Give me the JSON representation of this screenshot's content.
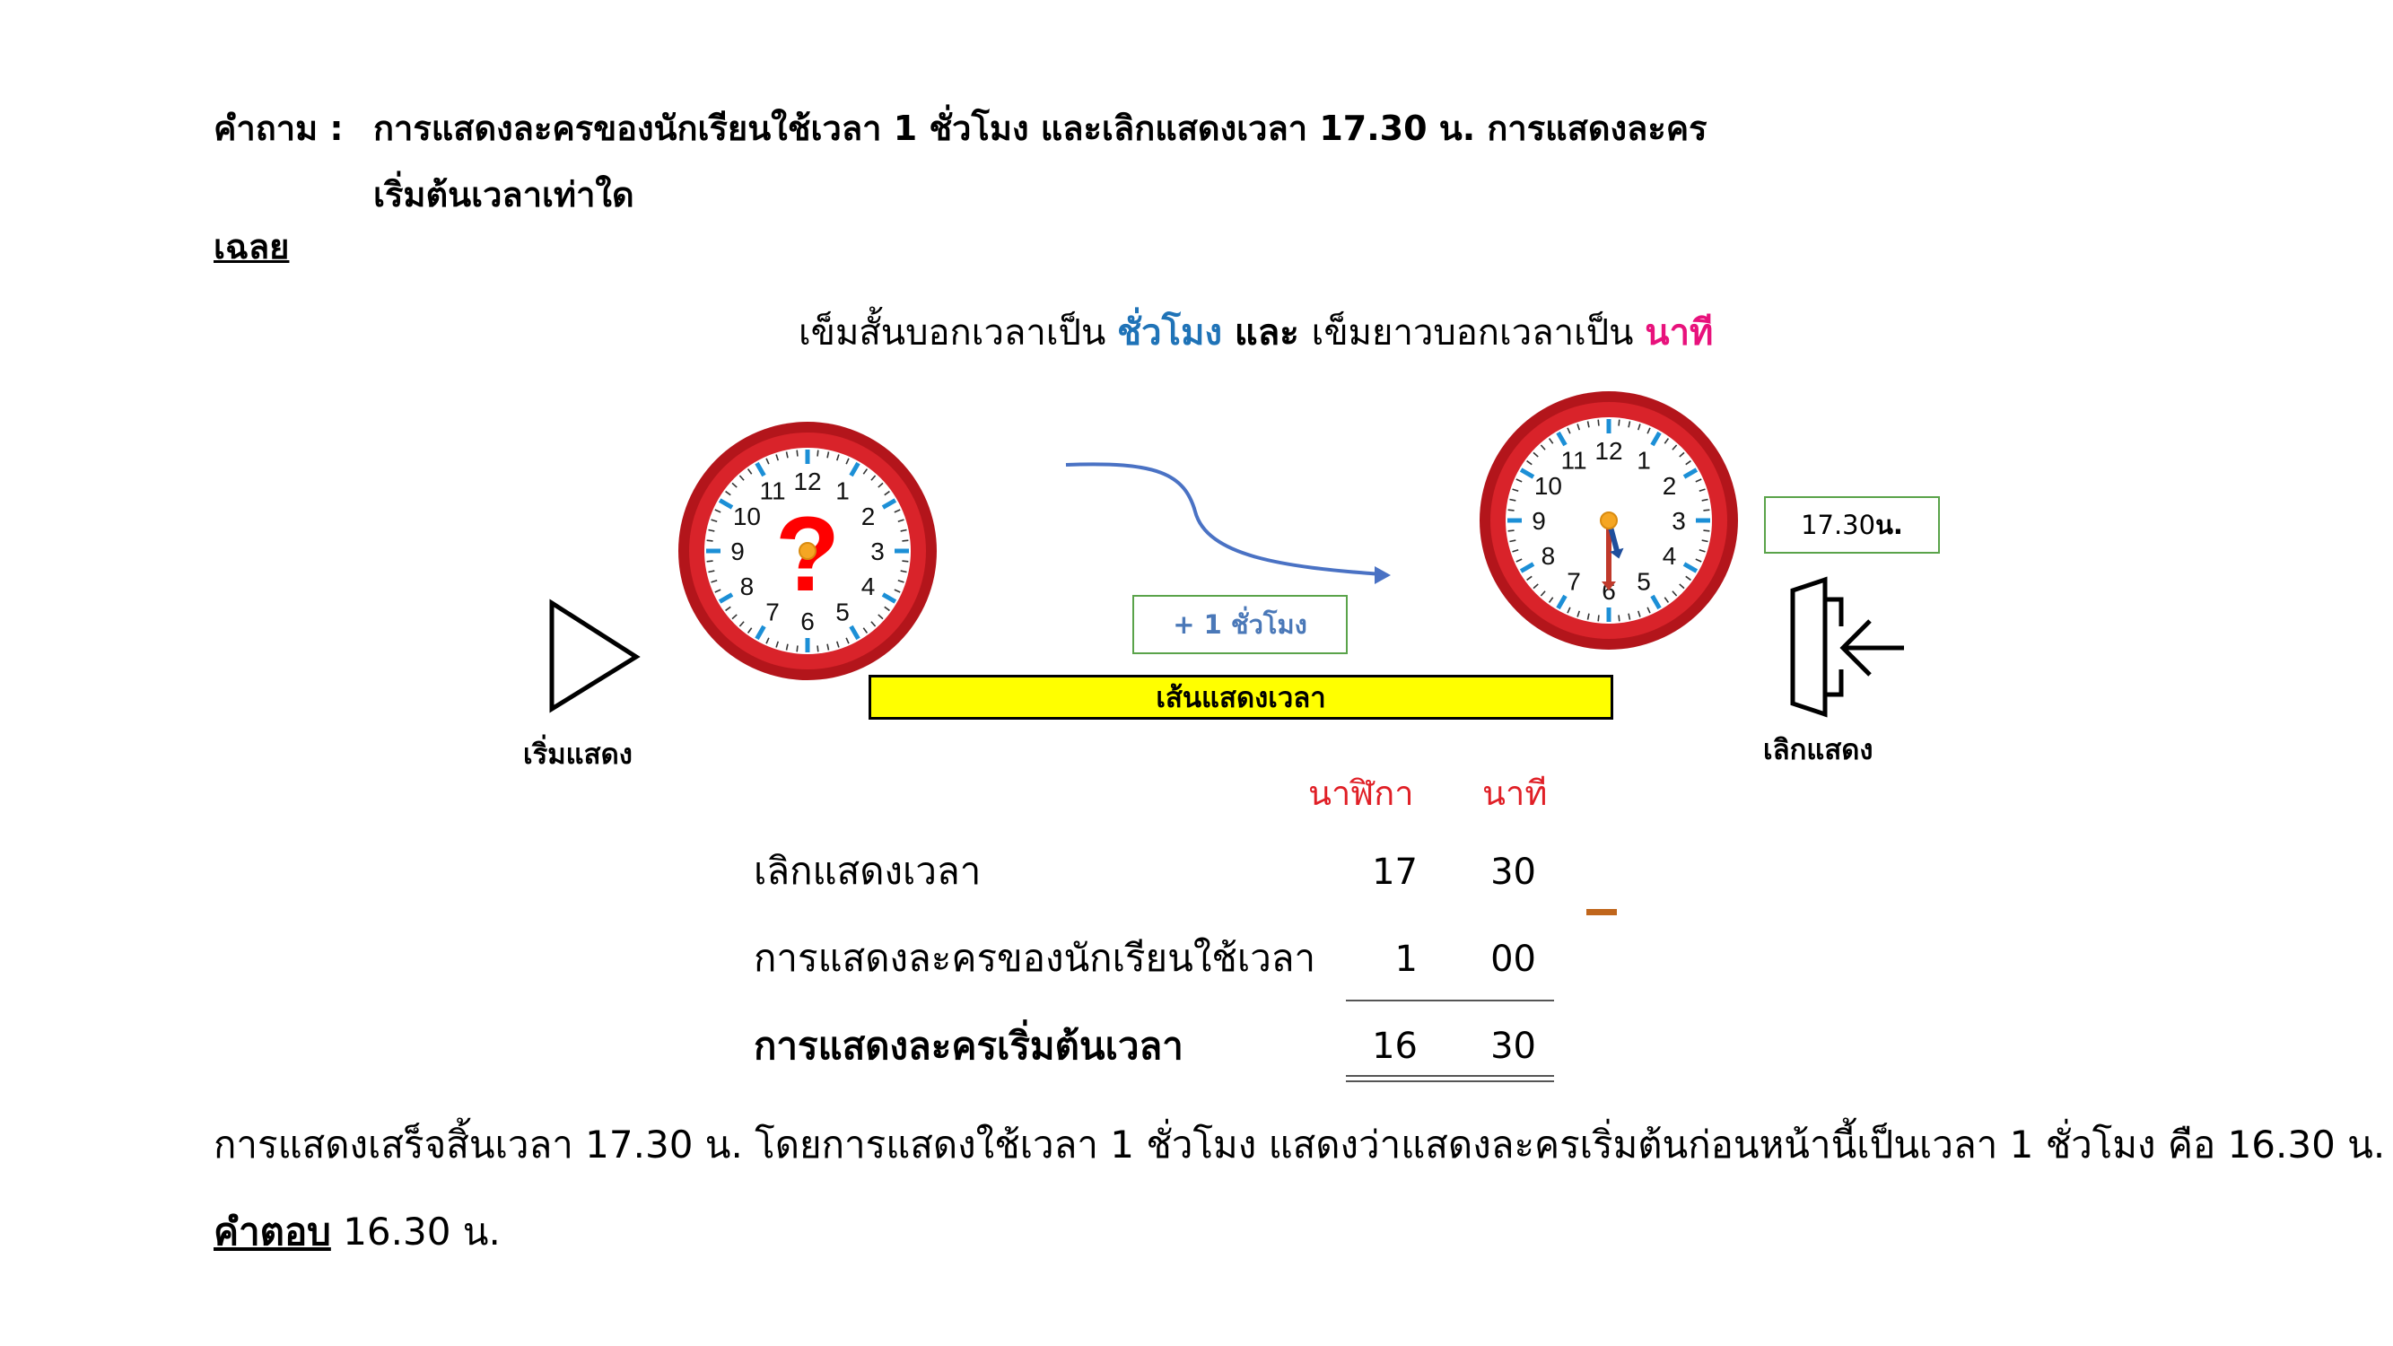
{
  "question": {
    "label": "คำถาม :",
    "line1": "การแสดงละครของนักเรียนใช้เวลา 1 ชั่วโมง และเลิกแสดงเวลา 17.30 น. การแสดงละคร",
    "line2": "เริ่มต้นเวลาเท่าใด"
  },
  "solution_label": "เฉลย",
  "hint": {
    "part1": "เข็มสั้นบอกเวลาเป็น ",
    "hours_word": "ชั่วโมง",
    "and_word": " และ ",
    "part2": " เข็มยาวบอกเวลาเป็น ",
    "minutes_word": "นาที",
    "hours_color": "#1f73b7",
    "minutes_color": "#e8127c"
  },
  "clock_start": {
    "numbers": [
      "12",
      "1",
      "2",
      "3",
      "4",
      "5",
      "6",
      "7",
      "8",
      "9",
      "10",
      "11"
    ],
    "unknown_mark": "?"
  },
  "clock_end": {
    "numbers": [
      "12",
      "1",
      "2",
      "3",
      "4",
      "5",
      "6",
      "7",
      "8",
      "9",
      "10",
      "11"
    ],
    "hour_value": 17,
    "minute_value": 30
  },
  "plus_hour_label": "+ 1 ชั่วโมง",
  "timeline_label": "เส้นแสดงเวลา",
  "end_time_box": {
    "number": "17.30 ",
    "unit": "น."
  },
  "start_label": "เริ่มแสดง",
  "end_label": "เลิกแสดง",
  "table": {
    "col_hours": "นาฬิกา",
    "col_minutes": "นาที",
    "rows": [
      {
        "label": "เลิกแสดงเวลา",
        "hours": "17",
        "minutes": "30"
      },
      {
        "label": "การแสดงละครของนักเรียนใช้เวลา",
        "hours": "1",
        "minutes": "00"
      },
      {
        "label": "การแสดงละครเริ่มต้นเวลา",
        "hours": "16",
        "minutes": "30"
      }
    ],
    "operator": "−"
  },
  "explanation": "การแสดงเสร็จสิ้นเวลา 17.30 น. โดยการแสดงใช้เวลา 1 ชั่วโมง แสดงว่าแสดงละครเริ่มต้นก่อนหน้านี้เป็นเวลา 1 ชั่วโมง คือ 16.30 น.",
  "answer": {
    "label": "คำตอบ",
    "value": " 16.30 น."
  },
  "colors": {
    "clock_rim": "#d9232a",
    "tick_blue": "#1c8fd6",
    "timeline_fill": "#ffff00",
    "box_border": "#5aa34a",
    "header_red": "#e01f26"
  }
}
